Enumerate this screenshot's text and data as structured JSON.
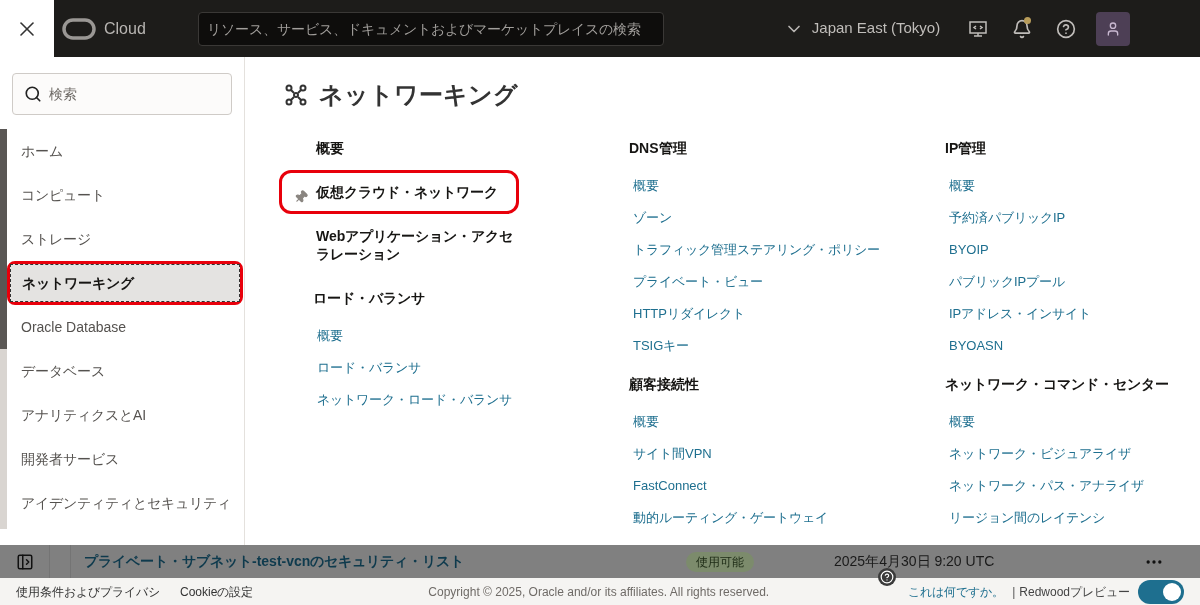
{
  "topbar": {
    "brand": "Cloud",
    "search": {
      "placeholder": "リソース、サービス、ドキュメントおよびマーケットプレイスの検索"
    },
    "region": "Japan East (Tokyo)",
    "notification_dot": true
  },
  "sidebar": {
    "search": {
      "placeholder": "検索"
    },
    "items": [
      {
        "label": "ホーム",
        "selected": false,
        "highlighted": false
      },
      {
        "label": "コンピュート",
        "selected": false,
        "highlighted": false
      },
      {
        "label": "ストレージ",
        "selected": false,
        "highlighted": false
      },
      {
        "label": "ネットワーキング",
        "selected": true,
        "highlighted": true
      },
      {
        "label": "Oracle Database",
        "selected": false,
        "highlighted": false
      },
      {
        "label": "データベース",
        "selected": false,
        "highlighted": false
      },
      {
        "label": "アナリティクスとAI",
        "selected": false,
        "highlighted": false
      },
      {
        "label": "開発者サービス",
        "selected": false,
        "highlighted": false
      },
      {
        "label": "アイデンティティとセキュリティ",
        "selected": false,
        "highlighted": false
      }
    ]
  },
  "panel": {
    "title": "ネットワーキング",
    "columns": [
      [
        {
          "kind": "item",
          "text": "概要",
          "pinned": false,
          "highlighted": false
        },
        {
          "kind": "item",
          "text": "仮想クラウド・ネットワーク",
          "pinned": true,
          "highlighted": true
        },
        {
          "kind": "item",
          "text": "Webアプリケーション・アクセラレーション",
          "pinned": false,
          "highlighted": false
        },
        {
          "kind": "heading",
          "text": "ロード・バランサ"
        },
        {
          "kind": "link",
          "text": "概要"
        },
        {
          "kind": "link",
          "text": "ロード・バランサ"
        },
        {
          "kind": "link",
          "text": "ネットワーク・ロード・バランサ"
        }
      ],
      [
        {
          "kind": "heading",
          "text": "DNS管理"
        },
        {
          "kind": "link",
          "text": "概要"
        },
        {
          "kind": "link",
          "text": "ゾーン"
        },
        {
          "kind": "link",
          "text": "トラフィック管理ステアリング・ポリシー"
        },
        {
          "kind": "link",
          "text": "プライベート・ビュー"
        },
        {
          "kind": "link",
          "text": "HTTPリダイレクト"
        },
        {
          "kind": "link",
          "text": "TSIGキー"
        },
        {
          "kind": "heading",
          "text": "顧客接続性"
        },
        {
          "kind": "link",
          "text": "概要"
        },
        {
          "kind": "link",
          "text": "サイト間VPN"
        },
        {
          "kind": "link",
          "text": "FastConnect"
        },
        {
          "kind": "link",
          "text": "動的ルーティング・ゲートウェイ"
        }
      ],
      [
        {
          "kind": "heading",
          "text": "IP管理"
        },
        {
          "kind": "link",
          "text": "概要"
        },
        {
          "kind": "link",
          "text": "予約済パブリックIP"
        },
        {
          "kind": "link",
          "text": "BYOIP"
        },
        {
          "kind": "link",
          "text": "パブリックIPプール"
        },
        {
          "kind": "link",
          "text": "IPアドレス・インサイト"
        },
        {
          "kind": "link",
          "text": "BYOASN"
        },
        {
          "kind": "heading",
          "text": "ネットワーク・コマンド・センター"
        },
        {
          "kind": "link",
          "text": "概要"
        },
        {
          "kind": "link",
          "text": "ネットワーク・ビジュアライザ"
        },
        {
          "kind": "link",
          "text": "ネットワーク・パス・アナライザ"
        },
        {
          "kind": "link",
          "text": "リージョン間のレイテンシ"
        }
      ]
    ]
  },
  "background_row": {
    "name": "プライベート・サブネット-test-vcnのセキュリティ・リスト",
    "status": "使用可能",
    "created": "2025年4月30日 9:20 UTC"
  },
  "footer": {
    "links": [
      "使用条件およびプライバシ",
      "Cookieの設定"
    ],
    "copyright": "Copyright © 2025, Oracle and/or its affiliates. All rights reserved.",
    "help_link": "これは何ですか。",
    "separator": "|",
    "preview_label": "Redwoodプレビュー",
    "preview_on": true
  }
}
